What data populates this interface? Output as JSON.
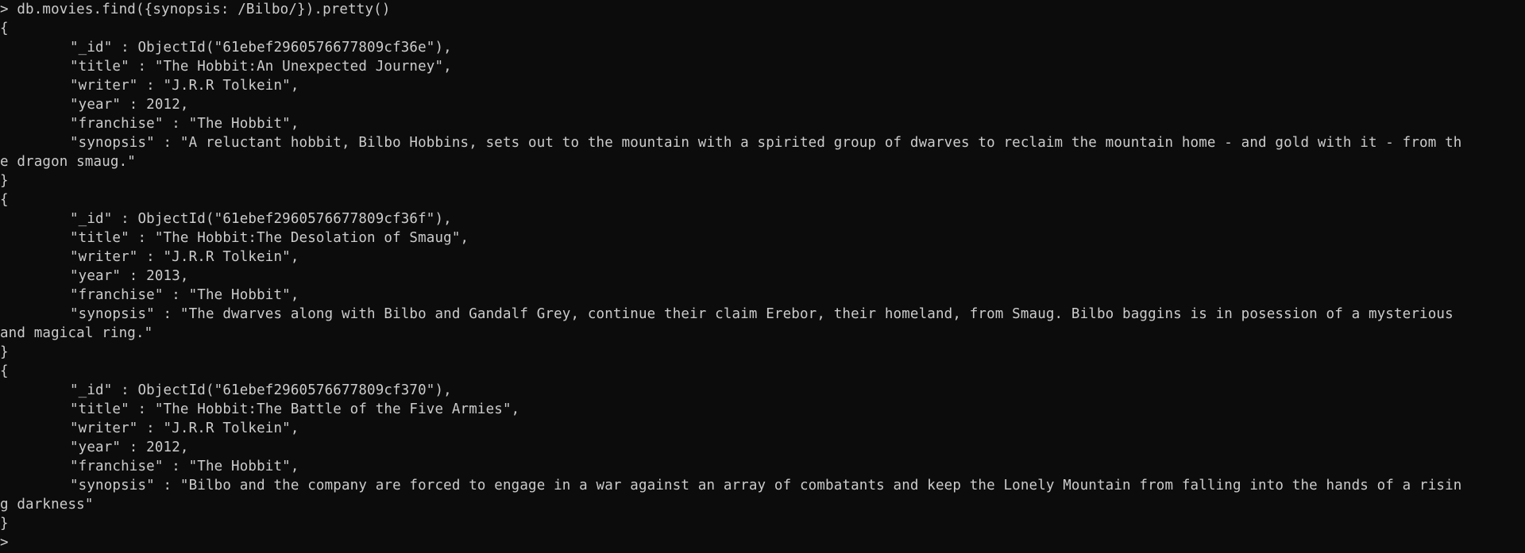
{
  "terminal": {
    "prompt_symbol": ">",
    "command": " db.movies.find({synopsis: /Bilbo/}).pretty()",
    "open_brace": "{",
    "close_brace": "}",
    "documents": [
      {
        "id_line": "\"_id\" : ObjectId(\"61ebef2960576677809cf36e\"),",
        "title_line": "\"title\" : \"The Hobbit:An Unexpected Journey\",",
        "writer_line": "\"writer\" : \"J.R.R Tolkein\",",
        "year_line": "\"year\" : 2012,",
        "franchise_line": "\"franchise\" : \"The Hobbit\",",
        "synopsis_line1": "\"synopsis\" : \"A reluctant hobbit, Bilbo Hobbins, sets out to the mountain with a spirited group of dwarves to reclaim the mountain home - and gold with it - from th",
        "synopsis_line2": "e dragon smaug.\""
      },
      {
        "id_line": "\"_id\" : ObjectId(\"61ebef2960576677809cf36f\"),",
        "title_line": "\"title\" : \"The Hobbit:The Desolation of Smaug\",",
        "writer_line": "\"writer\" : \"J.R.R Tolkein\",",
        "year_line": "\"year\" : 2013,",
        "franchise_line": "\"franchise\" : \"The Hobbit\",",
        "synopsis_line1": "\"synopsis\" : \"The dwarves along with Bilbo and Gandalf Grey, continue their claim Erebor, their homeland, from Smaug. Bilbo baggins is in posession of a mysterious",
        "synopsis_line2": "and magical ring.\""
      },
      {
        "id_line": "\"_id\" : ObjectId(\"61ebef2960576677809cf370\"),",
        "title_line": "\"title\" : \"The Hobbit:The Battle of the Five Armies\",",
        "writer_line": "\"writer\" : \"J.R.R Tolkein\",",
        "year_line": "\"year\" : 2012,",
        "franchise_line": "\"franchise\" : \"The Hobbit\",",
        "synopsis_line1": "\"synopsis\" : \"Bilbo and the company are forced to engage in a war against an array of combatants and keep the Lonely Mountain from falling into the hands of a risin",
        "synopsis_line2": "g darkness\""
      }
    ],
    "final_prompt": ">"
  }
}
